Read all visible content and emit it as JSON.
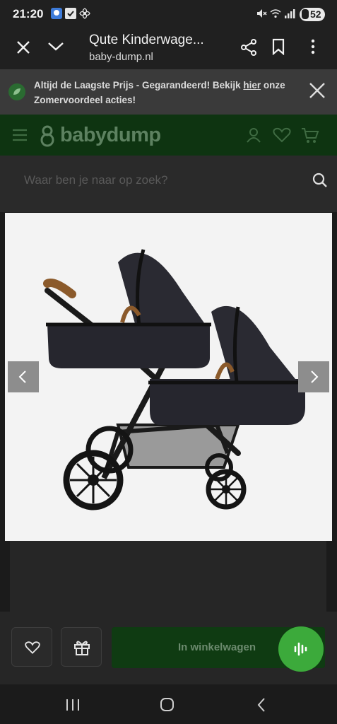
{
  "status_bar": {
    "time": "21:20",
    "battery": "52",
    "icons": [
      "app-icon",
      "check-icon",
      "fan-icon",
      "mute-icon",
      "wifi-icon",
      "signal-icon",
      "battery-icon"
    ]
  },
  "browser": {
    "page_title": "Qute Kinderwage...",
    "url": "baby-dump.nl",
    "icons": [
      "close-icon",
      "chevron-down-icon",
      "share-icon",
      "bookmark-icon",
      "more-vertical-icon"
    ]
  },
  "banner": {
    "text_before": "Altijd de Laagste Prijs - Gegarandeerd! Bekijk ",
    "link": "hier",
    "text_after": " onze Zomervoordeel acties!"
  },
  "header": {
    "brand": "babydump",
    "icons": [
      "menu-icon",
      "logo-icon",
      "account-icon",
      "heart-icon",
      "cart-icon"
    ]
  },
  "search": {
    "placeholder": "Waar ben je naar op zoek?"
  },
  "actions": {
    "add_to_cart": "In winkelwagen"
  },
  "colors": {
    "header_green": "#0e3411",
    "button_green": "#0f3b12",
    "fab_green": "#3caa3b"
  }
}
